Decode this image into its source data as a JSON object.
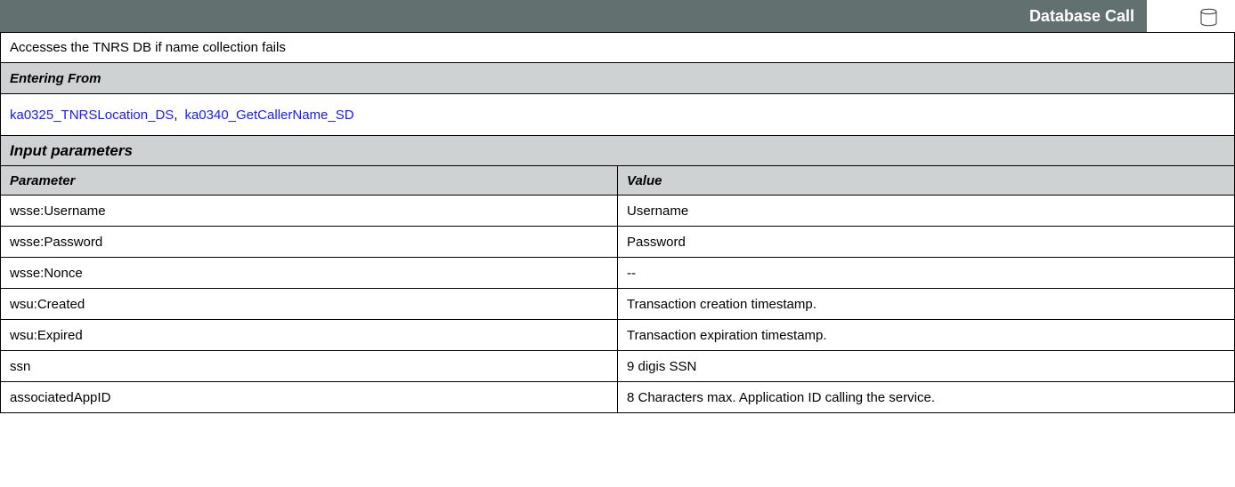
{
  "header": {
    "title": "Database Call",
    "icon": "database-icon"
  },
  "description": "Accesses the TNRS DB if name collection fails",
  "entering_from": {
    "label": "Entering From",
    "links": [
      "ka0325_TNRSLocation_DS",
      "ka0340_GetCallerName_SD"
    ],
    "separator": ","
  },
  "input_parameters": {
    "label": "Input parameters",
    "col_headers": {
      "parameter": "Parameter",
      "value": "Value"
    },
    "rows": [
      {
        "parameter": "wsse:Username",
        "value": "Username"
      },
      {
        "parameter": "wsse:Password",
        "value": "Password"
      },
      {
        "parameter": "wsse:Nonce",
        "value": "--"
      },
      {
        "parameter": "wsu:Created",
        "value": "Transaction creation timestamp."
      },
      {
        "parameter": "wsu:Expired",
        "value": "Transaction expiration timestamp."
      },
      {
        "parameter": "ssn",
        "value": "9 digis SSN"
      },
      {
        "parameter": "associatedAppID",
        "value": "8 Characters max.  Application ID calling the service."
      }
    ]
  },
  "colors": {
    "header_bg": "#637070",
    "section_bg": "#cfd2d2",
    "link": "#1a1aff"
  }
}
